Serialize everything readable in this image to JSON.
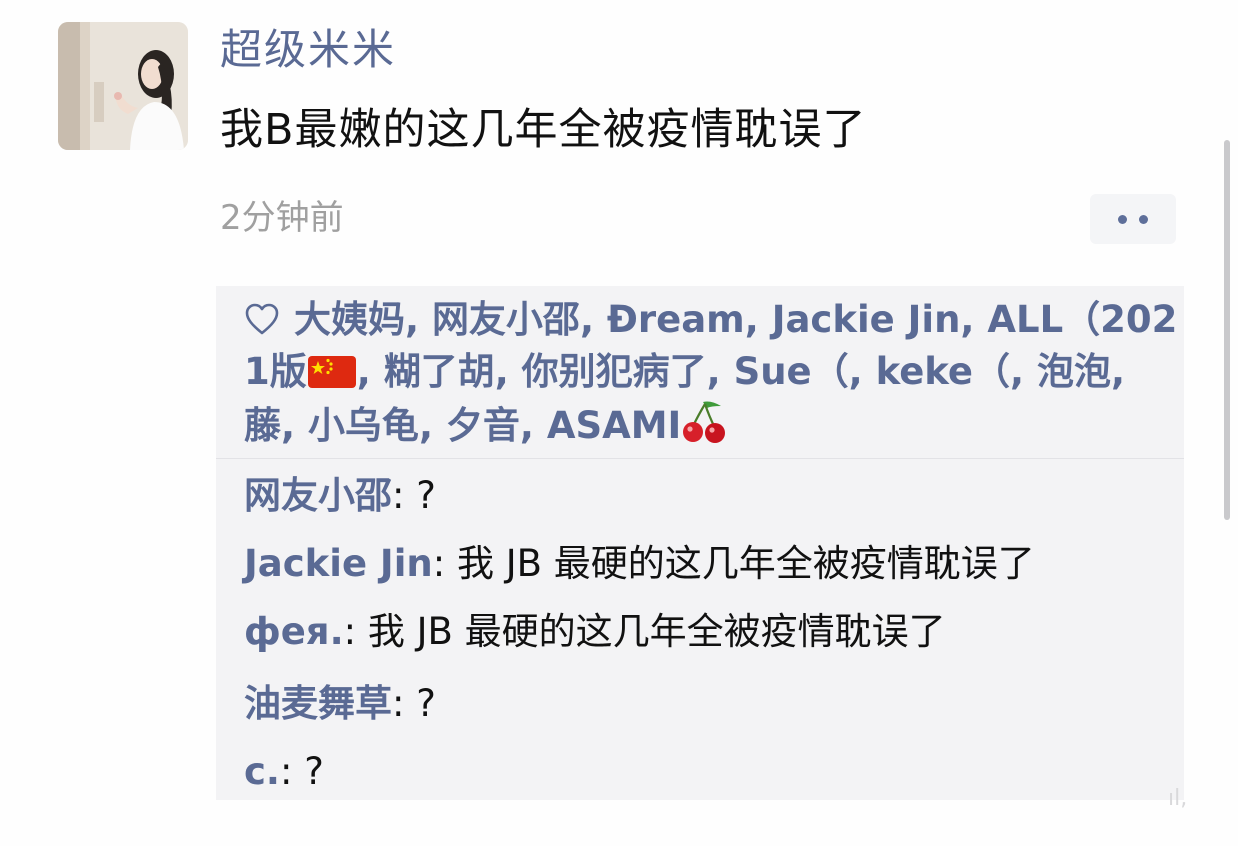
{
  "post": {
    "username": "超级米米",
    "text": "我B最嫩的这几年全被疫情耽误了",
    "timestamp": "2分钟前"
  },
  "likes": {
    "names": [
      "大姨妈",
      "网友小邵",
      "Đream",
      "Jackie Jin",
      "ALL（2021版",
      "糊了胡",
      "你别犯病了",
      "Sue（",
      "keke（",
      "泡泡",
      "藤",
      "小乌龟",
      "夕音",
      "ASAMI"
    ],
    "separator": ", ",
    "icons": {
      "heart": "heart-outline-icon",
      "flag": "china-flag-emoji",
      "cherry": "cherry-emoji"
    }
  },
  "comments": [
    {
      "author": "网友小邵",
      "sep": ": ",
      "text": "?"
    },
    {
      "author": "Jackie Jin",
      "sep": ": ",
      "text": "我 JB 最硬的这几年全被疫情耽误了"
    },
    {
      "author": "фея.",
      "sep": ": ",
      "text": "我 JB 最硬的这几年全被疫情耽误了"
    },
    {
      "author": "油麦舞草",
      "sep": ": ",
      "text": "?"
    },
    {
      "author": "c.",
      "sep": ": ",
      "text": "?"
    }
  ],
  "colors": {
    "name_blue": "#5a6a94",
    "text_black": "#111111",
    "timestamp_gray": "#a0a0a0",
    "panel_bg": "#f3f3f5"
  }
}
